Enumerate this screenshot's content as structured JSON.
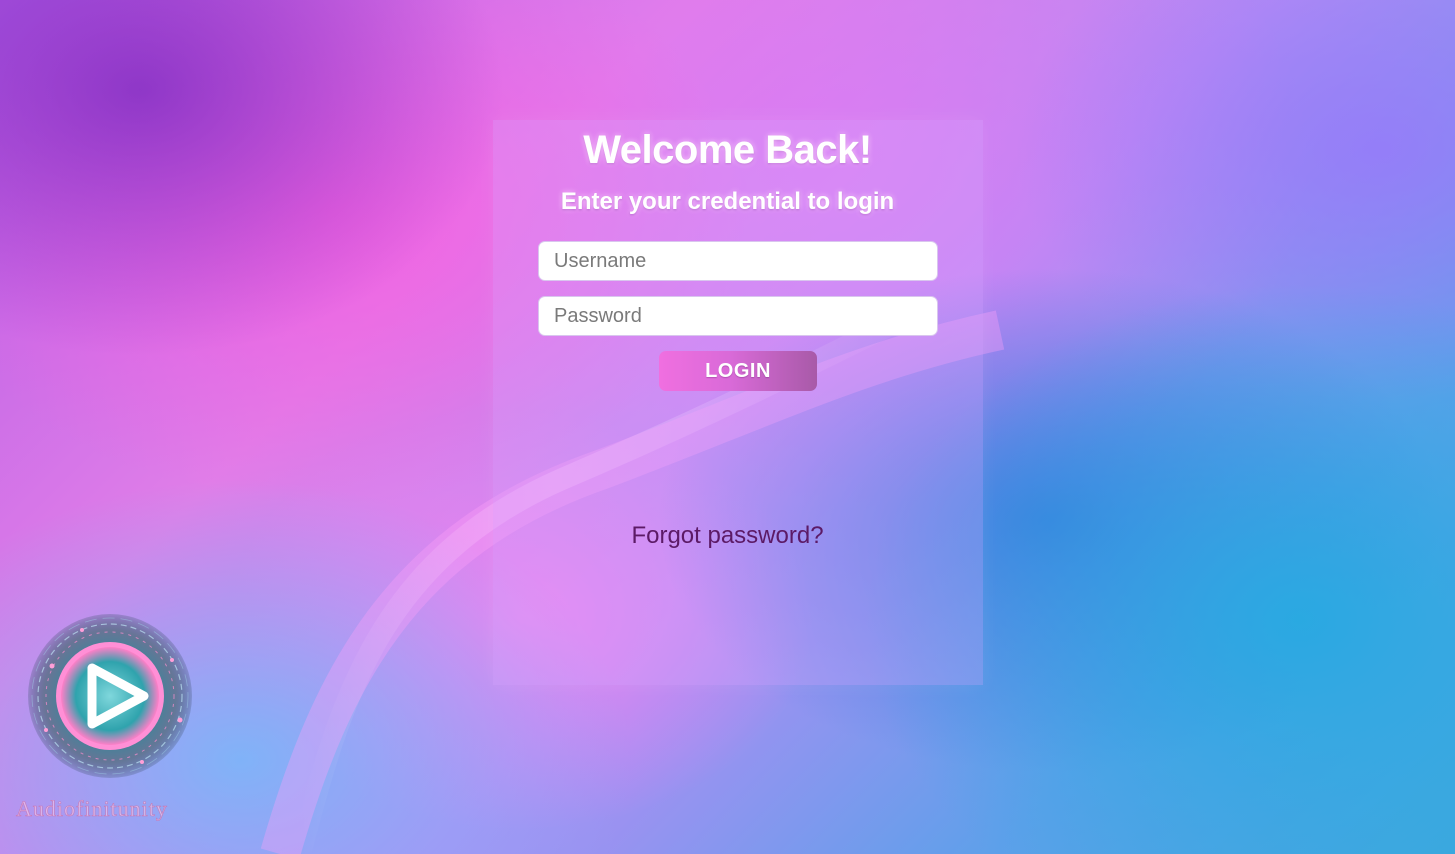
{
  "login": {
    "title": "Welcome Back!",
    "subtitle": "Enter your credential to login",
    "username_placeholder": "Username",
    "password_placeholder": "Password",
    "login_label": "LOGIN",
    "forgot_label": "Forgot password?"
  },
  "brand": {
    "logo_icon": "play-icon",
    "name": "Audiofinitunity"
  },
  "colors": {
    "button_start": "#f06fe0",
    "button_end": "#a85aa8",
    "forgot_link": "#5c1a66"
  }
}
